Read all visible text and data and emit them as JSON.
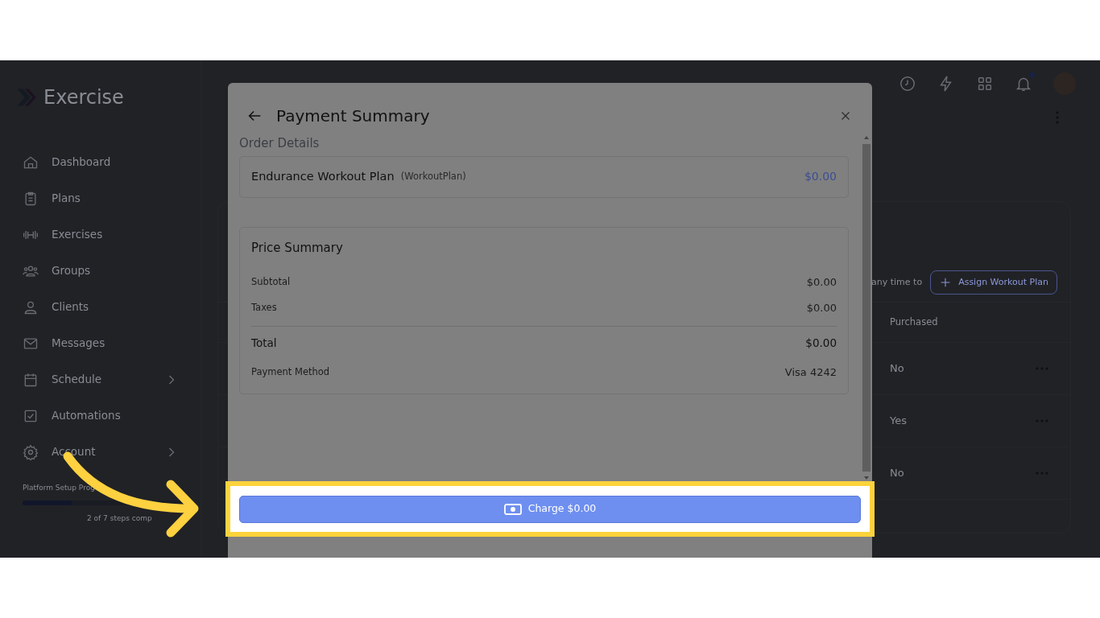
{
  "app": {
    "brand": "Exercise",
    "sidebar": {
      "items": [
        {
          "label": "Dashboard",
          "expandable": false
        },
        {
          "label": "Plans",
          "expandable": false
        },
        {
          "label": "Exercises",
          "expandable": false
        },
        {
          "label": "Groups",
          "expandable": false
        },
        {
          "label": "Clients",
          "expandable": false
        },
        {
          "label": "Messages",
          "expandable": false
        },
        {
          "label": "Schedule",
          "expandable": true
        },
        {
          "label": "Automations",
          "expandable": false
        },
        {
          "label": "Account",
          "expandable": true
        }
      ]
    },
    "progress": {
      "label": "Platform Setup Prog",
      "level": 0.29,
      "caption": "2 of 7 steps comp"
    },
    "topbar": {
      "notification_dot": true
    },
    "content": {
      "hint": "any time to",
      "assign_button": "Assign Workout Plan",
      "table": {
        "columns": [
          "Purchased"
        ],
        "rows": [
          {
            "purchased": "No"
          },
          {
            "purchased": "Yes"
          },
          {
            "purchased": "No"
          }
        ]
      }
    }
  },
  "modal": {
    "title": "Payment Summary",
    "order_details": {
      "heading": "Order Details",
      "item_name": "Endurance Workout Plan",
      "item_type": "(WorkoutPlan)",
      "price": "$0.00"
    },
    "price_summary": {
      "heading": "Price Summary",
      "lines": [
        {
          "label": "Subtotal",
          "value": "$0.00",
          "kind": "line"
        },
        {
          "label": "Taxes",
          "value": "$0.00",
          "kind": "line"
        },
        {
          "label": "Total",
          "value": "$0.00",
          "kind": "total"
        },
        {
          "label": "Payment Method",
          "value": "Visa 4242",
          "kind": "line"
        }
      ]
    },
    "charge_button": "Charge $0.00"
  }
}
